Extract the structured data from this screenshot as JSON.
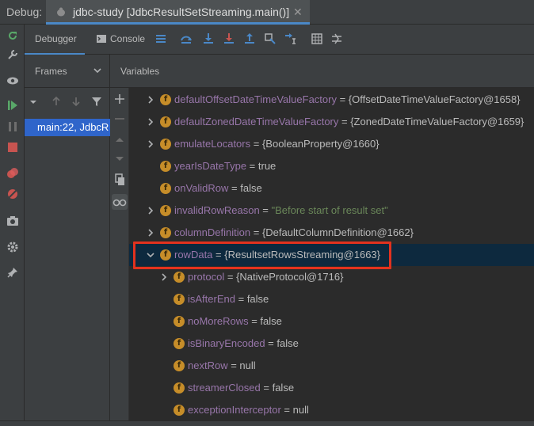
{
  "titlebar": {
    "debug_label": "Debug:",
    "session_tab": "jdbc-study [JdbcResultSetStreaming.main()]",
    "close_glyph": "✕"
  },
  "toolbar": {
    "debugger_label": "Debugger",
    "console_label": "Console",
    "icons": [
      "menu-icon",
      "show-execution-point-icon",
      "step-over-icon",
      "step-into-icon",
      "force-step-into-icon",
      "step-out-icon",
      "drop-frame-icon",
      "run-to-cursor-icon",
      "evaluate-expression-icon",
      "trace-icon"
    ]
  },
  "frames": {
    "header_label": "Frames",
    "selected_frame": "main:22, JdbcR"
  },
  "variables": {
    "header_label": "Variables",
    "rows": [
      {
        "name": "defaultOffsetDateTimeValueFactory",
        "eq": " = ",
        "value": "{OffsetDateTimeValueFactory@1658}",
        "expandable": true,
        "expanded": false,
        "depth": 0,
        "string": false
      },
      {
        "name": "defaultZonedDateTimeValueFactory",
        "eq": " = ",
        "value": "{ZonedDateTimeValueFactory@1659}",
        "expandable": true,
        "expanded": false,
        "depth": 0,
        "string": false
      },
      {
        "name": "emulateLocators",
        "eq": " = ",
        "value": "{BooleanProperty@1660}",
        "expandable": true,
        "expanded": false,
        "depth": 0,
        "string": false
      },
      {
        "name": "yearIsDateType",
        "eq": " = ",
        "value": "true",
        "expandable": false,
        "expanded": false,
        "depth": 0,
        "string": false
      },
      {
        "name": "onValidRow",
        "eq": " = ",
        "value": "false",
        "expandable": false,
        "expanded": false,
        "depth": 0,
        "string": false
      },
      {
        "name": "invalidRowReason",
        "eq": " = ",
        "value": "\"Before start of result set\"",
        "expandable": true,
        "expanded": false,
        "depth": 0,
        "string": true
      },
      {
        "name": "columnDefinition",
        "eq": " = ",
        "value": "{DefaultColumnDefinition@1662}",
        "expandable": true,
        "expanded": false,
        "depth": 0,
        "string": false
      },
      {
        "name": "rowData",
        "eq": " = ",
        "value": "{ResultsetRowsStreaming@1663}",
        "expandable": true,
        "expanded": true,
        "depth": 0,
        "string": false,
        "selected": true
      },
      {
        "name": "protocol",
        "eq": " = ",
        "value": "{NativeProtocol@1716}",
        "expandable": true,
        "expanded": false,
        "depth": 1,
        "string": false
      },
      {
        "name": "isAfterEnd",
        "eq": " = ",
        "value": "false",
        "expandable": false,
        "expanded": false,
        "depth": 1,
        "string": false
      },
      {
        "name": "noMoreRows",
        "eq": " = ",
        "value": "false",
        "expandable": false,
        "expanded": false,
        "depth": 1,
        "string": false
      },
      {
        "name": "isBinaryEncoded",
        "eq": " = ",
        "value": "false",
        "expandable": false,
        "expanded": false,
        "depth": 1,
        "string": false
      },
      {
        "name": "nextRow",
        "eq": " = ",
        "value": "null",
        "expandable": false,
        "expanded": false,
        "depth": 1,
        "string": false
      },
      {
        "name": "streamerClosed",
        "eq": " = ",
        "value": "false",
        "expandable": false,
        "expanded": false,
        "depth": 1,
        "string": false
      },
      {
        "name": "exceptionInterceptor",
        "eq": " = ",
        "value": "null",
        "expandable": false,
        "expanded": false,
        "depth": 1,
        "string": false
      }
    ]
  },
  "colors": {
    "accent": "#4a88c7",
    "field_name": "#9876aa",
    "string_value": "#6a8759",
    "field_icon": "#c68d29",
    "highlight": "#e2321e",
    "selected_frame": "#2f65ca"
  }
}
